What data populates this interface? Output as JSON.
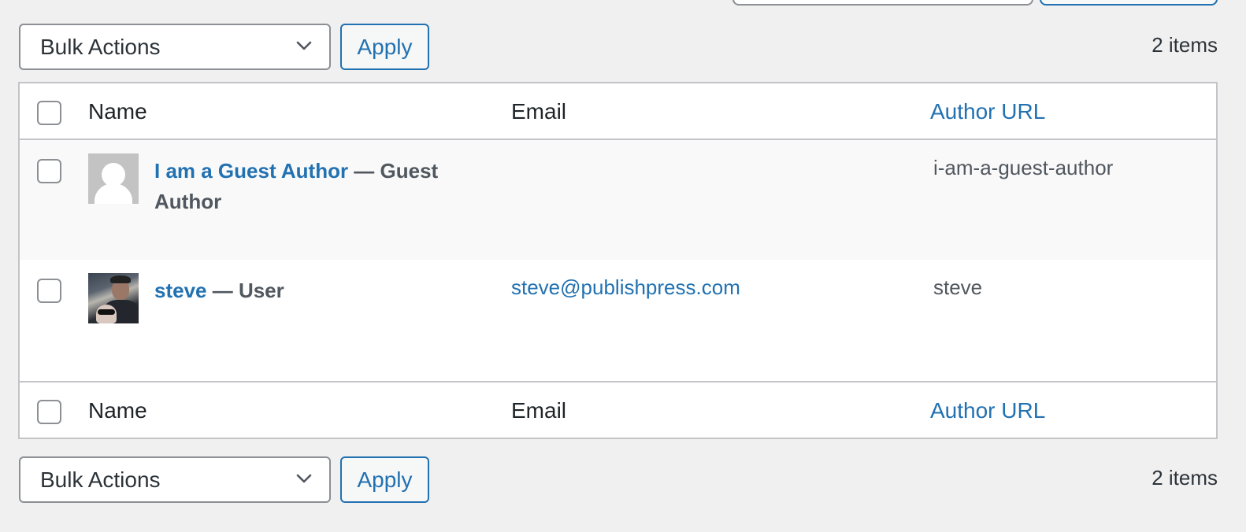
{
  "top_tablenav": {
    "bulk_actions_label": "Bulk Actions",
    "apply_label": "Apply",
    "items_count": "2 items"
  },
  "bottom_tablenav": {
    "bulk_actions_label": "Bulk Actions",
    "apply_label": "Apply",
    "items_count": "2 items"
  },
  "table": {
    "columns": {
      "name": "Name",
      "email": "Email",
      "author_url": "Author URL"
    },
    "rows": [
      {
        "name": "I am a Guest Author",
        "role": " — Guest Author",
        "email": "",
        "author_url": "i-am-a-guest-author",
        "avatar": "default-avatar-icon"
      },
      {
        "name": "steve",
        "role": " — User",
        "email": "steve@publishpress.com",
        "author_url": "steve",
        "avatar": "user-photo"
      }
    ]
  },
  "colors": {
    "accent": "#2271b1",
    "background": "#f0f0f1",
    "border": "#c3c4c7",
    "text": "#1d2327",
    "muted_text": "#50575e"
  }
}
